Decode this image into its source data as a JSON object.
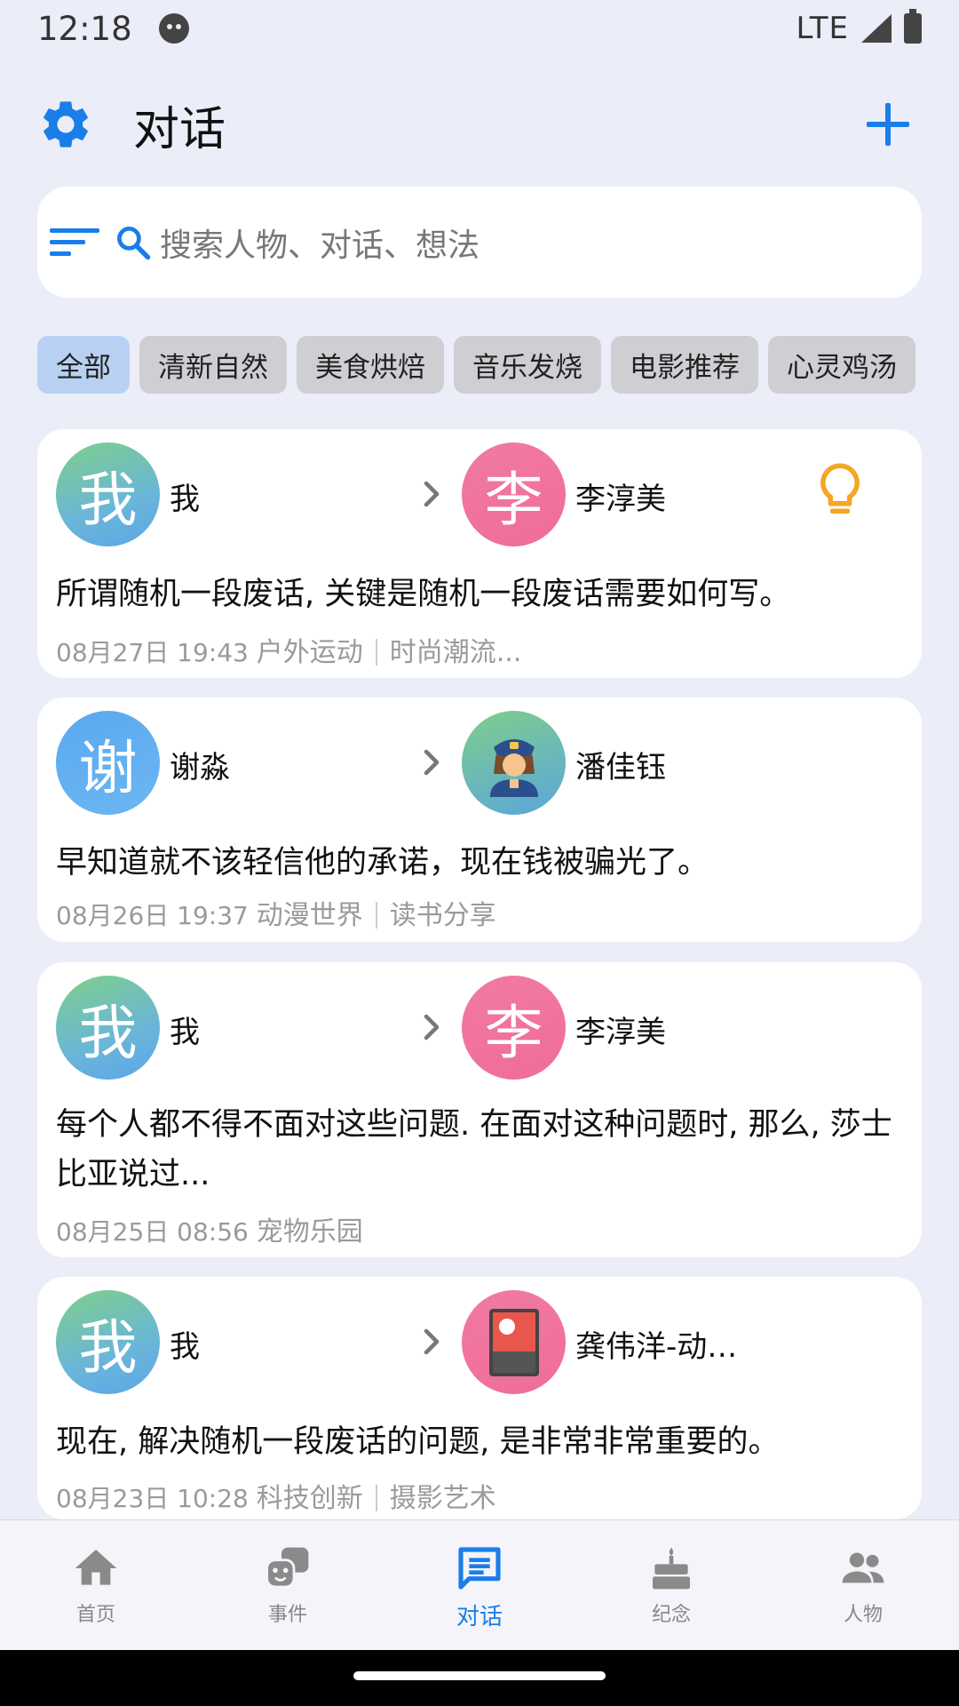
{
  "status_bar": {
    "time": "12:18",
    "network": "LTE"
  },
  "header": {
    "title": "对话"
  },
  "search": {
    "placeholder": "搜索人物、对话、想法"
  },
  "chips": [
    {
      "label": "全部",
      "active": true
    },
    {
      "label": "清新自然"
    },
    {
      "label": "美食烘焙"
    },
    {
      "label": "音乐发烧"
    },
    {
      "label": "电影推荐"
    },
    {
      "label": "心灵鸡汤"
    }
  ],
  "conversations": [
    {
      "from": {
        "avatar_text": "我",
        "name": "我"
      },
      "to": {
        "avatar_text": "李",
        "name": "李淳美"
      },
      "message": "所谓随机一段废话, 关键是随机一段废话需要如何写。",
      "date": "08月27日 19:43",
      "tag1": "户外运动",
      "tag2": "时尚潮流...",
      "has_idea_icon": true
    },
    {
      "from": {
        "avatar_text": "谢",
        "name": "谢淼"
      },
      "to": {
        "avatar_icon": "police-officer-emoji",
        "name": "潘佳钰"
      },
      "message": "早知道就不该轻信他的承诺，现在钱被骗光了。",
      "date": "08月26日 19:37",
      "tag1": "动漫世界",
      "tag2": "读书分享"
    },
    {
      "from": {
        "avatar_text": "我",
        "name": "我"
      },
      "to": {
        "avatar_text": "李",
        "name": "李淳美"
      },
      "message": "每个人都不得不面对这些问题. 在面对这种问题时, 那么, 莎士比亚说过...",
      "date": "08月25日 08:56",
      "tag1": "宠物乐园"
    },
    {
      "from": {
        "avatar_text": "我",
        "name": "我"
      },
      "to": {
        "avatar_icon": "photo-card-icon",
        "name": "龚伟洋-动…"
      },
      "message": "现在, 解决随机一段废话的问题, 是非常非常重要的。",
      "date": "08月23日 10:28",
      "tag1": "科技创新",
      "tag2": "摄影艺术"
    }
  ],
  "bottom_nav": [
    {
      "label": "首页",
      "icon": "home-icon"
    },
    {
      "label": "事件",
      "icon": "masks-icon"
    },
    {
      "label": "对话",
      "icon": "chat-icon",
      "active": true
    },
    {
      "label": "纪念",
      "icon": "cake-icon"
    },
    {
      "label": "人物",
      "icon": "people-icon"
    }
  ],
  "colors": {
    "accent": "#1a7ee8",
    "background": "#ebedf8",
    "idea": "#f5a623"
  }
}
